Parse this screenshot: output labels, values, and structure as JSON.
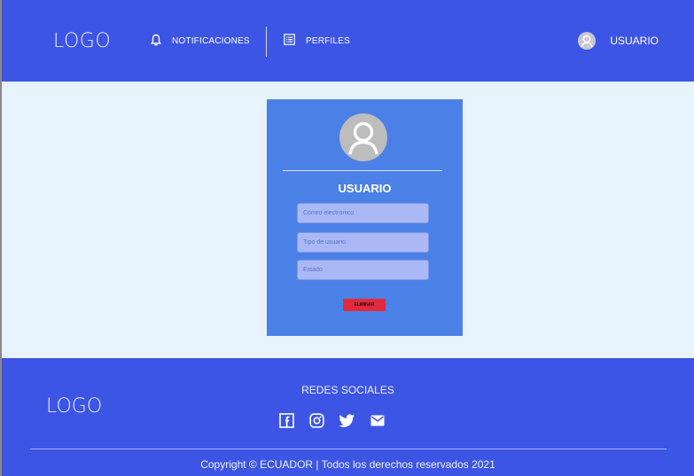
{
  "header": {
    "logo": "LOGO",
    "nav": [
      {
        "label": "NOTIFICACIONES",
        "icon": "bell-icon"
      },
      {
        "label": "PERFILES",
        "icon": "list-icon"
      }
    ],
    "user": {
      "label": "USUARIO",
      "icon": "user-avatar-icon"
    }
  },
  "card": {
    "title": "USUARIO",
    "fields": {
      "email_placeholder": "Correo electrónico",
      "type_placeholder": "Tipo de usuario",
      "status_placeholder": "Estado"
    },
    "delete_label": "ELIMINAR"
  },
  "footer": {
    "logo": "LOGO",
    "social_title": "REDES SOCIALES",
    "social_icons": [
      "facebook-icon",
      "instagram-icon",
      "twitter-icon",
      "mail-icon"
    ],
    "copyright": "Copyright © ECUADOR  |  Todos los derechos reservados 2021"
  },
  "colors": {
    "primary": "#3d55e4",
    "card": "#4b81e6",
    "background": "#e6f2fc",
    "danger": "#e32a3c"
  }
}
